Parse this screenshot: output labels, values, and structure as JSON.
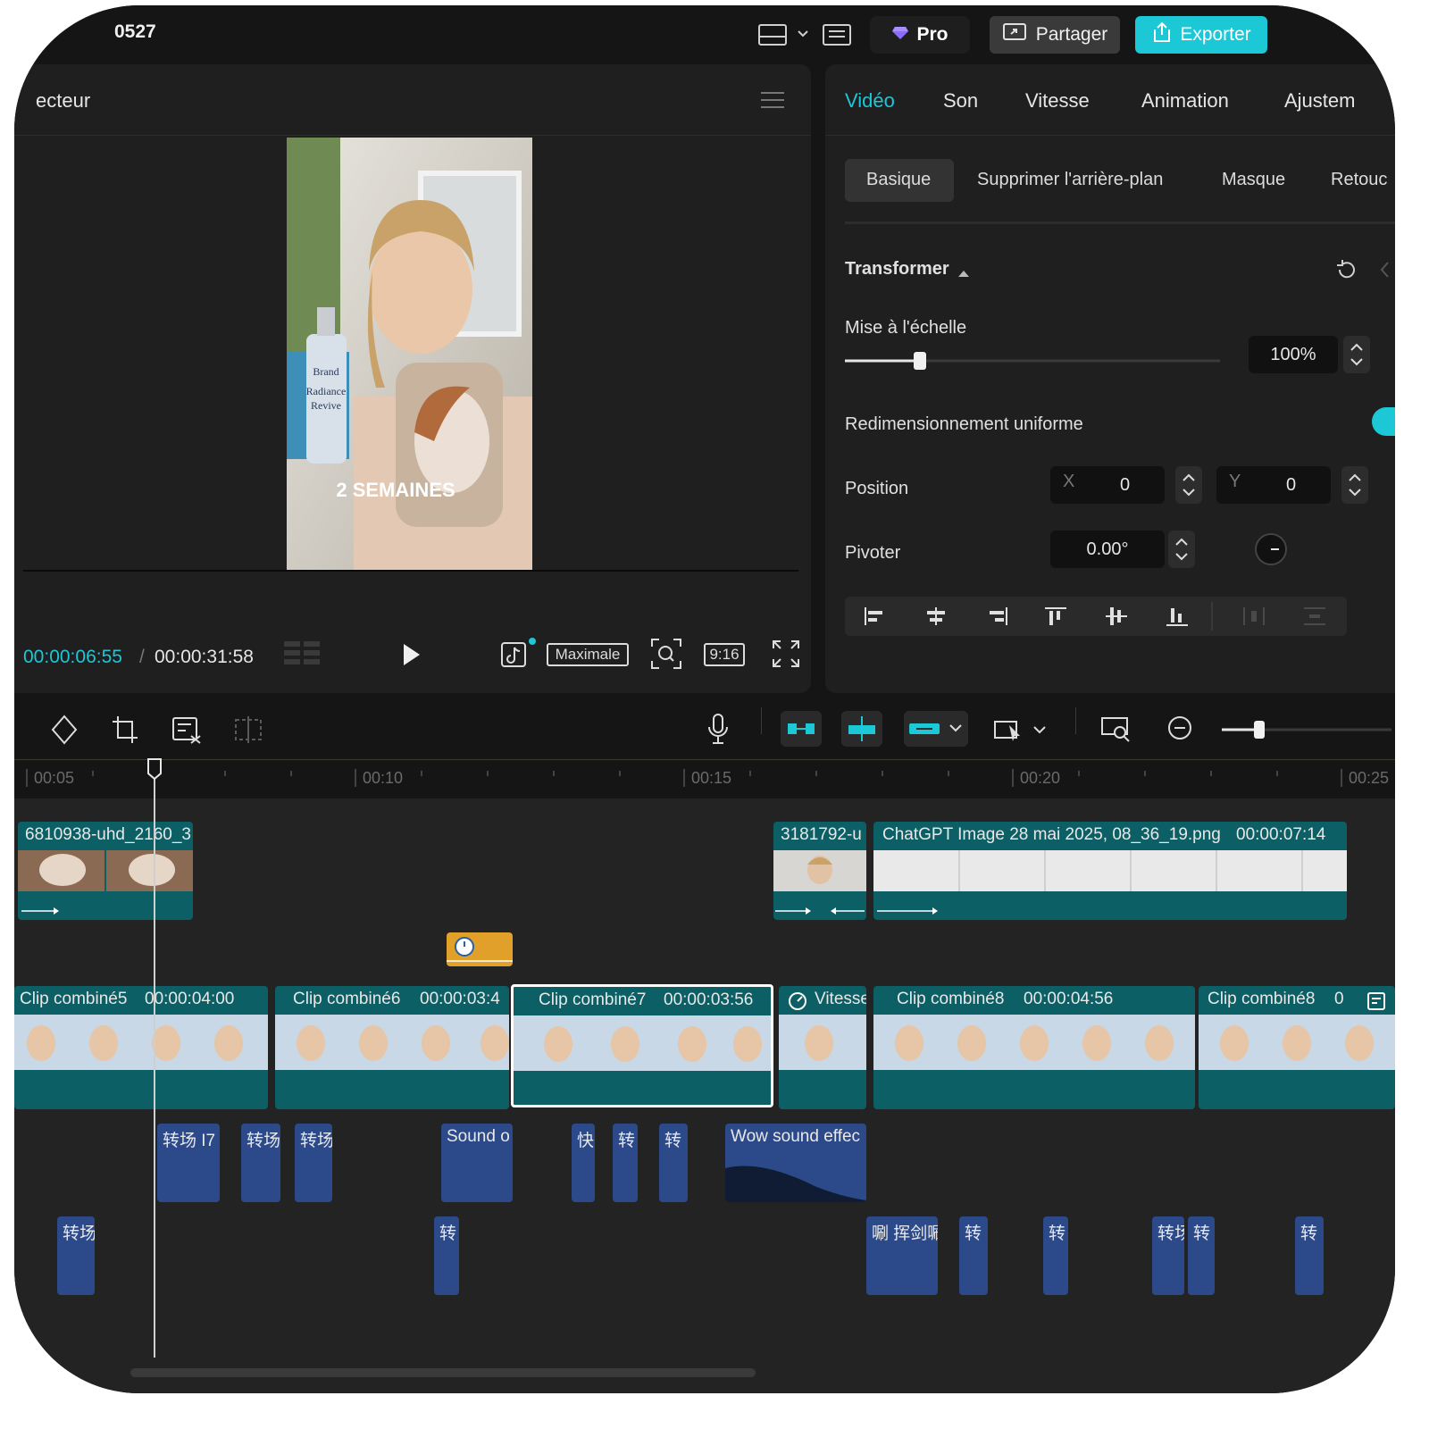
{
  "window": {
    "title": "0527"
  },
  "topbar": {
    "pro_label": "Pro",
    "share_label": "Partager",
    "export_label": "Exporter"
  },
  "player": {
    "title": "ecteur",
    "current_time": "00:00:06:55",
    "separator": "/",
    "total_time": "00:00:31:58",
    "quality_label": "Maximale",
    "ratio_label": "9:16",
    "overlay_text": "2 SEMAINES",
    "bottle_lines": [
      "Brand",
      "Radiance",
      "Revive"
    ]
  },
  "props": {
    "tabs": [
      "Vidéo",
      "Son",
      "Vitesse",
      "Animation",
      "Ajustem"
    ],
    "active_tab": "Vidéo",
    "subtabs": [
      "Basique",
      "Supprimer l'arrière-plan",
      "Masque",
      "Retouc"
    ],
    "section_title": "Transformer",
    "scale_label": "Mise à l'échelle",
    "scale_value": "100%",
    "scale_fraction": 0.2,
    "uniform_label": "Redimensionnement uniforme",
    "position_label": "Position",
    "x_label": "X",
    "x_value": "0",
    "y_label": "Y",
    "y_value": "0",
    "rotate_label": "Pivoter",
    "rotate_value": "0.00°"
  },
  "ruler": {
    "ticks": [
      "00:05",
      "00:10",
      "00:15",
      "00:20",
      "00:25"
    ]
  },
  "tracks": {
    "top": [
      {
        "title": "6810938-uhd_2160_3",
        "duration": ""
      },
      {
        "title": "3181792-u",
        "duration": ""
      },
      {
        "title": "ChatGPT Image 28 mai 2025, 08_36_19.png",
        "duration": "00:00:07:14"
      }
    ],
    "main": [
      {
        "title": "Clip combiné5",
        "duration": "00:00:04:00"
      },
      {
        "title": "Clip combiné6",
        "duration": "00:00:03:4"
      },
      {
        "title": "Clip combiné7",
        "duration": "00:00:03:56"
      },
      {
        "title": "Vitesse",
        "duration": ""
      },
      {
        "title": "Clip combiné8",
        "duration": "00:00:04:56"
      },
      {
        "title": "Clip combiné8",
        "duration": "0"
      }
    ],
    "audio1": [
      "转场 I7",
      "转场",
      "转场",
      "Sound o",
      "快",
      "转",
      "转",
      "Wow sound effec"
    ],
    "audio2": [
      "转场",
      "转",
      "唰 挥剑唰",
      "转",
      "转",
      "转场",
      "转",
      "转"
    ]
  },
  "colors": {
    "accent": "#1cc7d6",
    "clip": "#0c5f64",
    "audio": "#2c4a8a",
    "marker": "#e0a02a"
  }
}
